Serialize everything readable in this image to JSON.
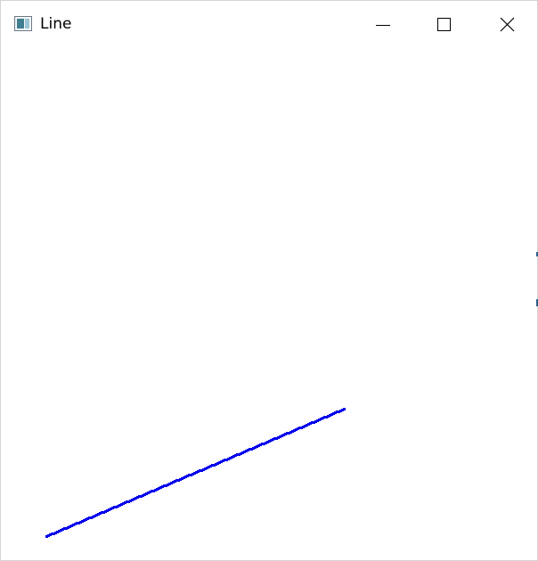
{
  "window": {
    "title": "Line"
  },
  "titlebar": {
    "icon": "app-window-icon",
    "buttons": [
      {
        "name": "minimize",
        "icon": "minimize-icon"
      },
      {
        "name": "maximize",
        "icon": "maximize-icon"
      },
      {
        "name": "close",
        "icon": "close-icon"
      }
    ]
  },
  "canvas": {
    "line_color": "#0000ee",
    "background": "#ffffff"
  }
}
